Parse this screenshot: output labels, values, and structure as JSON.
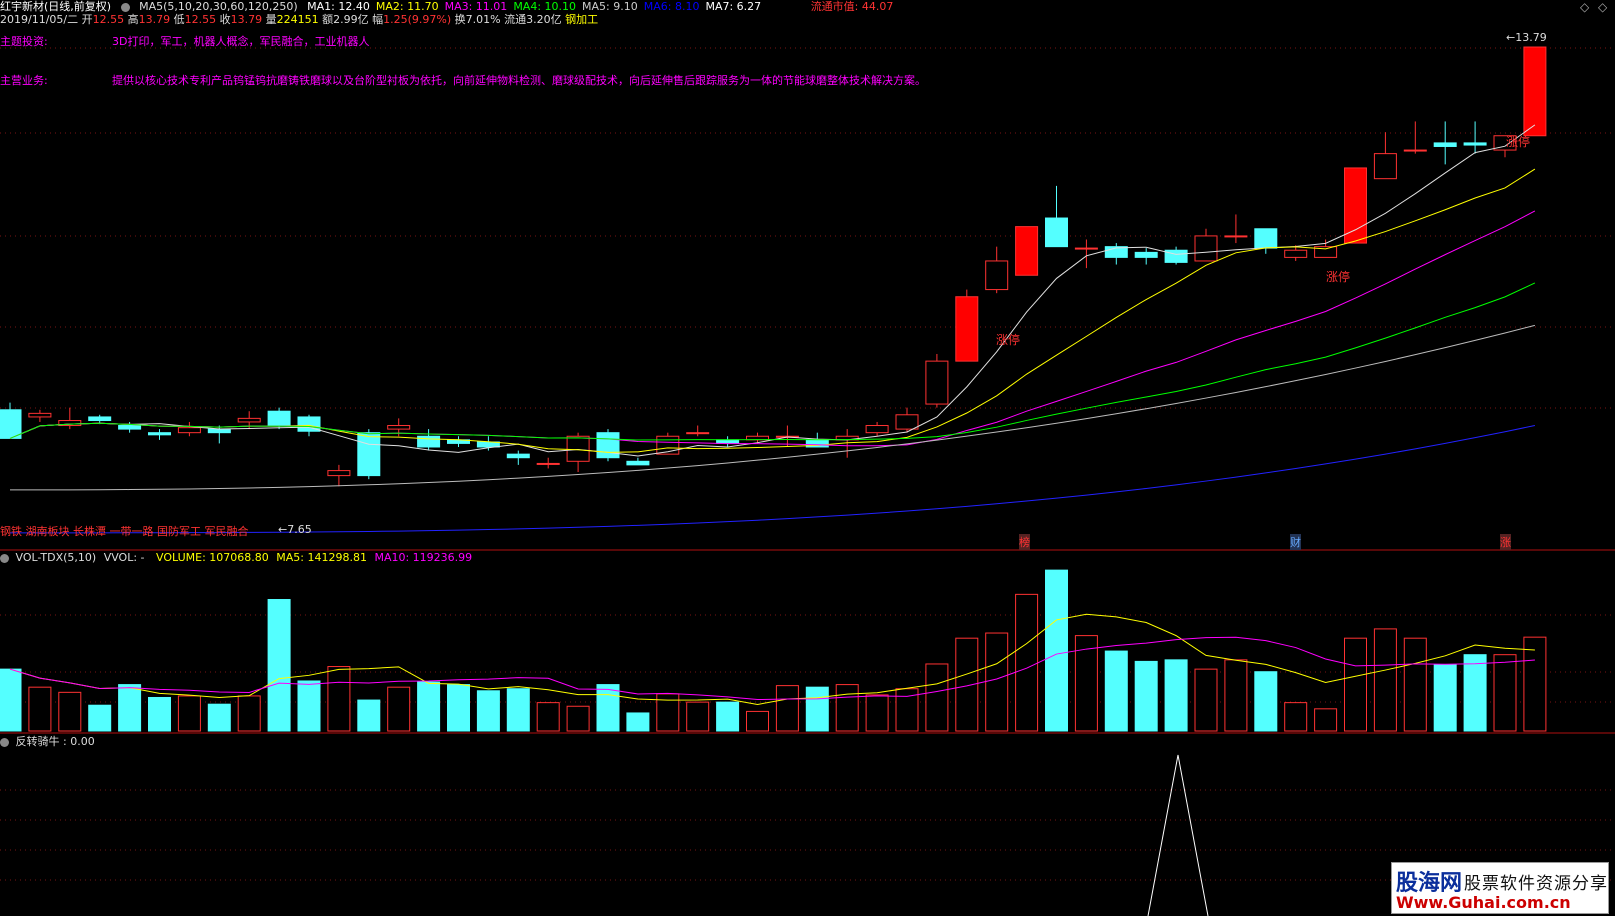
{
  "header": {
    "stock_name": "红宇新材(日线,前复权)",
    "ma_setting": "MA5(5,10,20,30,60,120,250)",
    "ma": [
      {
        "label": "MA1: 12.40",
        "color": "#ffffff"
      },
      {
        "label": "MA2: 11.70",
        "color": "#ffff00"
      },
      {
        "label": "MA3: 11.01",
        "color": "#ff00ff"
      },
      {
        "label": "MA4: 10.10",
        "color": "#00ff00"
      },
      {
        "label": "MA5: 9.10",
        "color": "#cccccc"
      },
      {
        "label": "MA6: 8.10",
        "color": "#0000ff"
      },
      {
        "label": "MA7: 6.27",
        "color": "#ffffff"
      }
    ],
    "market_cap": "流通市值: 44.07",
    "nav_left": "◇",
    "nav_right": "◇"
  },
  "quote": {
    "date": "2019/11/05/二",
    "open_label": "开",
    "open": "12.55",
    "high_label": "高",
    "high": "13.79",
    "low_label": "低",
    "low": "12.55",
    "close_label": "收",
    "close": "13.79",
    "vol_label": "量",
    "vol": "224151",
    "amount_label": "额",
    "amount": "2.99亿",
    "change_label": "幅",
    "change": "1.25(9.97%)",
    "turnover_label": "换",
    "turnover": "7.01%",
    "float_label": "流通",
    "float": "3.20亿",
    "industry": "钢加工"
  },
  "info": {
    "theme_label": "主题投资:",
    "theme_value": "3D打印，军工，机器人概念，军民融合，工业机器人",
    "business_label": "主营业务:",
    "business_value": "提供以核心技术专利产品钨锰钨抗磨铸铁磨球以及台阶型衬板为依托，向前延伸物料检测、磨球级配技术，向后延伸售后跟踪服务为一体的节能球磨整体技术解决方案。"
  },
  "main_chart": {
    "high_label": "13.79",
    "low_label": "7.65",
    "limit_up": "涨停",
    "concept_line": "钢铁 湖南板块 长株潭 一带一路 国防军工 军民融合",
    "markers": [
      "榜",
      "财",
      "涨"
    ]
  },
  "volume_panel": {
    "title": "VOL-TDX(5,10)",
    "vvol": "VVOL: -",
    "volume": "VOLUME: 107068.80",
    "ma5": "MA5: 141298.81",
    "ma10": "MA10: 119236.99"
  },
  "indicator_panel": {
    "title": "反转骑牛",
    "value": ": 0.00"
  },
  "watermark": {
    "line1": "股海网",
    "line2": "股票软件资源分享",
    "line3": "Www.Guhai.com.cn"
  },
  "chart_data": {
    "type": "candlestick",
    "price_range": [
      6.9,
      14.0
    ],
    "candles": [
      [
        8.72,
        8.32,
        8.82,
        8.32
      ],
      [
        8.62,
        8.67,
        8.72,
        8.55
      ],
      [
        8.5,
        8.57,
        8.75,
        8.45
      ],
      [
        8.62,
        8.57,
        8.65,
        8.52
      ],
      [
        8.5,
        8.45,
        8.55,
        8.4
      ],
      [
        8.4,
        8.37,
        8.45,
        8.3
      ],
      [
        8.4,
        8.47,
        8.55,
        8.35
      ],
      [
        8.45,
        8.4,
        8.5,
        8.25
      ],
      [
        8.55,
        8.6,
        8.7,
        8.45
      ],
      [
        8.7,
        8.5,
        8.75,
        8.45
      ],
      [
        8.62,
        8.42,
        8.65,
        8.35
      ],
      [
        7.8,
        7.87,
        7.95,
        7.65
      ],
      [
        8.4,
        7.8,
        8.45,
        7.75
      ],
      [
        8.45,
        8.5,
        8.6,
        8.35
      ],
      [
        8.35,
        8.2,
        8.45,
        8.15
      ],
      [
        8.3,
        8.25,
        8.35,
        8.2
      ],
      [
        8.27,
        8.2,
        8.35,
        8.15
      ],
      [
        8.1,
        8.05,
        8.15,
        7.95
      ],
      [
        7.97,
        7.97,
        8.05,
        7.9
      ],
      [
        8.0,
        8.35,
        8.4,
        7.85
      ],
      [
        8.4,
        8.05,
        8.45,
        8.0
      ],
      [
        8.0,
        7.95,
        8.05,
        7.95
      ],
      [
        8.1,
        8.35,
        8.4,
        8.1
      ],
      [
        8.4,
        8.4,
        8.5,
        8.35
      ],
      [
        8.3,
        8.25,
        8.35,
        8.2
      ],
      [
        8.3,
        8.35,
        8.4,
        8.25
      ],
      [
        8.35,
        8.35,
        8.5,
        8.2
      ],
      [
        8.3,
        8.2,
        8.4,
        8.2
      ],
      [
        8.3,
        8.35,
        8.45,
        8.05
      ],
      [
        8.4,
        8.5,
        8.55,
        8.35
      ],
      [
        8.45,
        8.65,
        8.75,
        8.4
      ],
      [
        8.8,
        9.4,
        9.5,
        8.75
      ],
      [
        9.4,
        10.3,
        10.4,
        9.4
      ],
      [
        10.4,
        10.8,
        11.0,
        10.35
      ],
      [
        10.6,
        11.28,
        11.28,
        10.6
      ],
      [
        11.4,
        11.0,
        11.85,
        11.0
      ],
      [
        10.98,
        10.98,
        11.1,
        10.7
      ],
      [
        11.0,
        10.85,
        11.05,
        10.75
      ],
      [
        10.92,
        10.85,
        10.98,
        10.75
      ],
      [
        10.95,
        10.78,
        11.0,
        10.75
      ],
      [
        10.8,
        11.15,
        11.25,
        10.8
      ],
      [
        11.15,
        11.15,
        11.45,
        11.05
      ],
      [
        11.25,
        10.98,
        11.25,
        10.9
      ],
      [
        10.85,
        10.95,
        11.02,
        10.8
      ],
      [
        10.85,
        11.0,
        11.1,
        10.85
      ],
      [
        11.05,
        12.1,
        12.1,
        11.05
      ],
      [
        11.95,
        12.3,
        12.6,
        11.95
      ],
      [
        12.35,
        12.35,
        12.75,
        12.3
      ],
      [
        12.45,
        12.4,
        12.75,
        12.15
      ],
      [
        12.45,
        12.42,
        12.75,
        12.3
      ],
      [
        12.35,
        12.55,
        12.55,
        12.25
      ],
      [
        12.55,
        13.79,
        13.79,
        12.55
      ]
    ],
    "volume": [
      120,
      85,
      75,
      50,
      90,
      65,
      68,
      52,
      68,
      255,
      97,
      125,
      60,
      85,
      95,
      90,
      78,
      82,
      55,
      48,
      90,
      35,
      72,
      56,
      56,
      38,
      88,
      85,
      90,
      70,
      82,
      130,
      180,
      190,
      265,
      312,
      185,
      155,
      135,
      138,
      120,
      138,
      115,
      55,
      43,
      180,
      198,
      180,
      128,
      148,
      148,
      182
    ],
    "vol_range": [
      0,
      320
    ]
  }
}
